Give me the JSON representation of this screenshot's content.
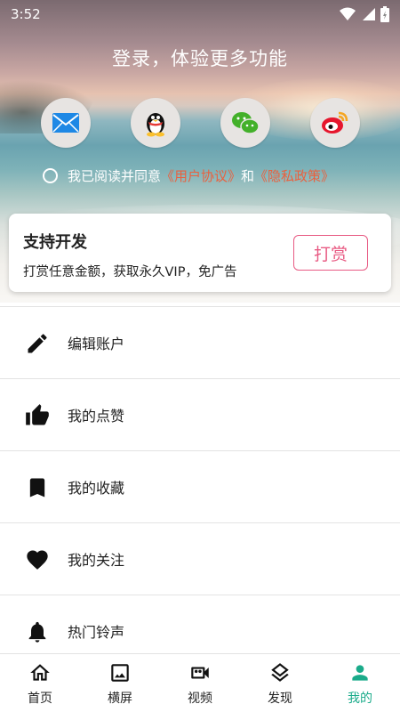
{
  "status": {
    "time": "3:52"
  },
  "login": {
    "title": "登录，体验更多功能",
    "social": [
      {
        "icon": "mail-icon"
      },
      {
        "icon": "qq-icon"
      },
      {
        "icon": "wechat-icon"
      },
      {
        "icon": "weibo-icon"
      }
    ],
    "agree_prefix": "我已阅读并同意",
    "user_agreement": "《用户协议》",
    "and": "和",
    "privacy_policy": "《隐私政策》"
  },
  "support": {
    "title": "支持开发",
    "subtitle": "打赏任意金额，获取永久VIP，免广告",
    "button": "打赏"
  },
  "menu": [
    {
      "label": "编辑账户",
      "icon": "pencil-icon"
    },
    {
      "label": "我的点赞",
      "icon": "thumbs-up-icon"
    },
    {
      "label": "我的收藏",
      "icon": "bookmark-icon"
    },
    {
      "label": "我的关注",
      "icon": "heart-icon"
    },
    {
      "label": "热门铃声",
      "icon": "bell-icon"
    }
  ],
  "tabs": [
    {
      "label": "首页",
      "icon": "home-icon"
    },
    {
      "label": "横屏",
      "icon": "image-icon"
    },
    {
      "label": "视频",
      "icon": "video-icon"
    },
    {
      "label": "发现",
      "icon": "layers-icon"
    },
    {
      "label": "我的",
      "icon": "person-icon",
      "active": true
    }
  ],
  "colors": {
    "accent": "#1aab8a",
    "link": "#e9613f",
    "tip": "#e85a83"
  }
}
